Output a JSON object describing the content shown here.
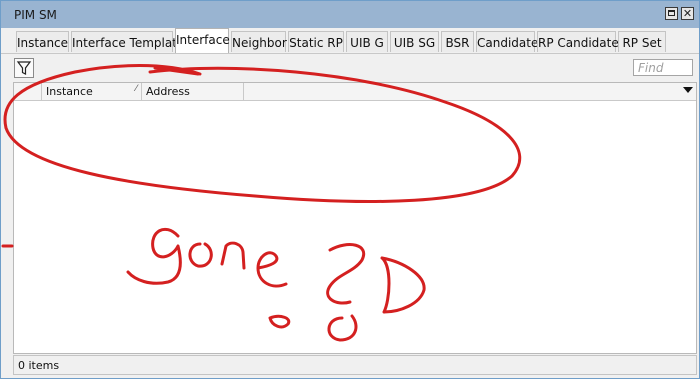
{
  "window": {
    "title": "PIM SM",
    "maximize_icon": "maximize-icon",
    "close_glyph": "✕"
  },
  "tabs": [
    {
      "label": "Instance",
      "active": false
    },
    {
      "label": "Interface Template",
      "active": false
    },
    {
      "label": "Interface",
      "active": true
    },
    {
      "label": "Neighbor",
      "active": false
    },
    {
      "label": "Static RP",
      "active": false
    },
    {
      "label": "UIB G",
      "active": false
    },
    {
      "label": "UIB SG",
      "active": false
    },
    {
      "label": "BSR",
      "active": false
    },
    {
      "label": "Candidate",
      "active": false
    },
    {
      "label": "RP Candidate",
      "active": false
    },
    {
      "label": "RP Set",
      "active": false
    }
  ],
  "toolbar": {
    "filter_icon": "filter-icon",
    "find_placeholder": "Find"
  },
  "table": {
    "columns": [
      "Instance",
      "Address"
    ],
    "rows": []
  },
  "status": {
    "items": "0 items"
  },
  "annotation": {
    "handwritten_text": "gone?D",
    "stroke_color": "#d42020"
  }
}
